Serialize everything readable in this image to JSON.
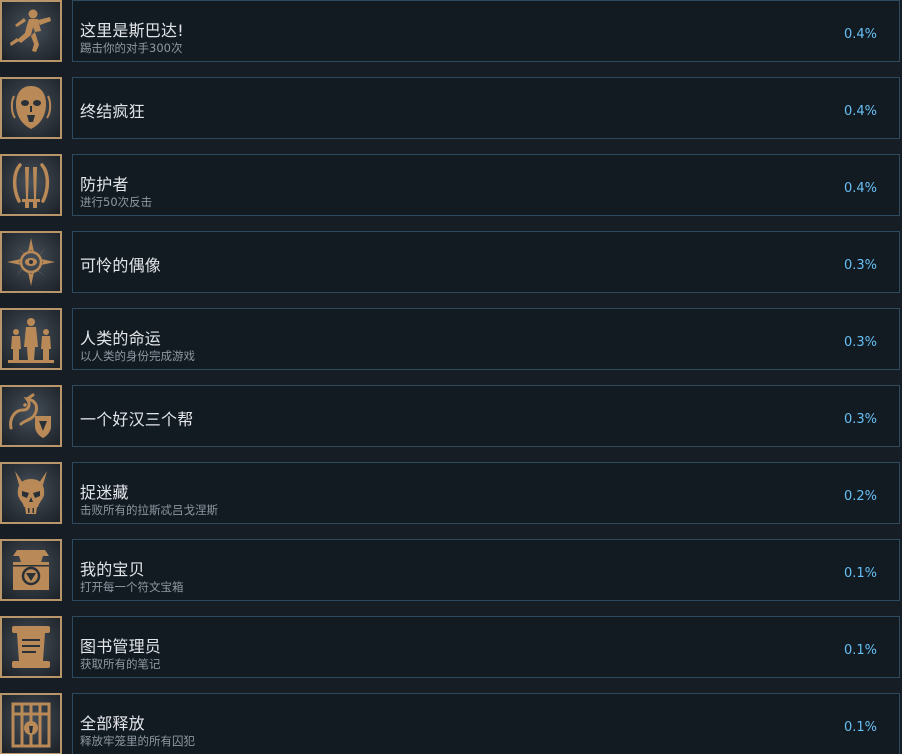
{
  "achievements": [
    {
      "title": "这里是斯巴达!",
      "desc": "踢击你的对手300次",
      "percent": "0.4%",
      "icon": "kicking-warrior-icon"
    },
    {
      "title": "终结疯狂",
      "desc": "",
      "percent": "0.4%",
      "icon": "masked-face-icon"
    },
    {
      "title": "防护者",
      "desc": "进行50次反击",
      "percent": "0.4%",
      "icon": "crossed-blades-icon"
    },
    {
      "title": "可怜的偶像",
      "desc": "",
      "percent": "0.3%",
      "icon": "eye-sigil-icon"
    },
    {
      "title": "人类的命运",
      "desc": "以人类的身份完成游戏",
      "percent": "0.3%",
      "icon": "human-figures-icon"
    },
    {
      "title": "一个好汉三个帮",
      "desc": "",
      "percent": "0.3%",
      "icon": "dragon-shield-icon"
    },
    {
      "title": "捉迷藏",
      "desc": "击败所有的拉斯忒吕戈涅斯",
      "percent": "0.2%",
      "icon": "horned-skull-icon"
    },
    {
      "title": "我的宝贝",
      "desc": "打开每一个符文宝箱",
      "percent": "0.1%",
      "icon": "rune-chest-icon"
    },
    {
      "title": "图书管理员",
      "desc": "获取所有的笔记",
      "percent": "0.1%",
      "icon": "scroll-icon"
    },
    {
      "title": "全部释放",
      "desc": "释放牢笼里的所有囚犯",
      "percent": "0.1%",
      "icon": "cage-lock-icon"
    }
  ]
}
